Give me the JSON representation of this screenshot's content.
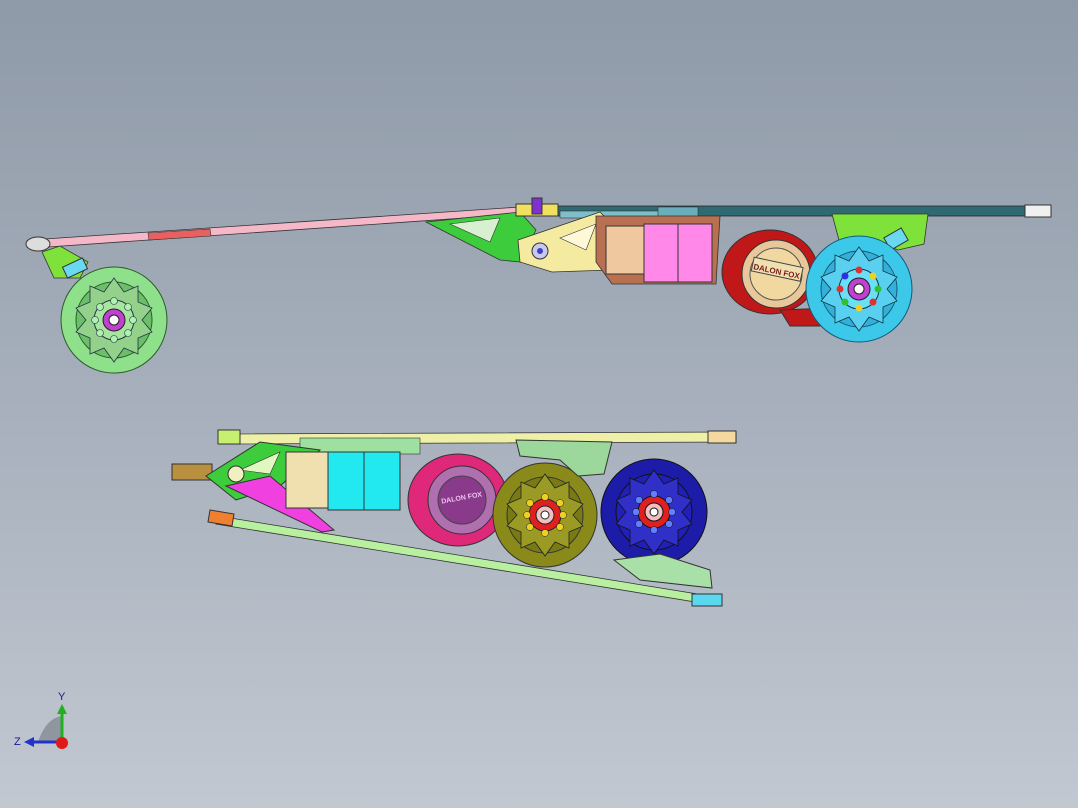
{
  "viewport": {
    "background_top": "#8f9aa8",
    "background_bottom": "#c2c8d1"
  },
  "triad": {
    "y_label": "Y",
    "z_label": "Z",
    "y_color": "#22b022",
    "z_color": "#2233cc",
    "x_color": "#e01818"
  },
  "models": [
    {
      "name": "unfolded-skateboard",
      "motor_label": "DALON FOX",
      "colors": {
        "deck": "#2f6a72",
        "front_wheel": "#8fe08a",
        "rear_wheel": "#3cc8e8",
        "motor": "#c01818",
        "motor_face": "#f0d8a0",
        "battery": "#ff88e8",
        "bracket": "#3ccc3c",
        "hinge": "#f4eaa0"
      }
    },
    {
      "name": "folded-skateboard",
      "motor_label": "DALON FOX",
      "colors": {
        "deck": "#eef0a8",
        "front_wheel": "#8a8a1a",
        "rear_wheel": "#1c1ca8",
        "motor": "#e0287a",
        "motor_face": "#b070b0",
        "battery": "#22e8f0",
        "bracket": "#3ccc3c",
        "strut": "#b8f0a0"
      }
    }
  ]
}
